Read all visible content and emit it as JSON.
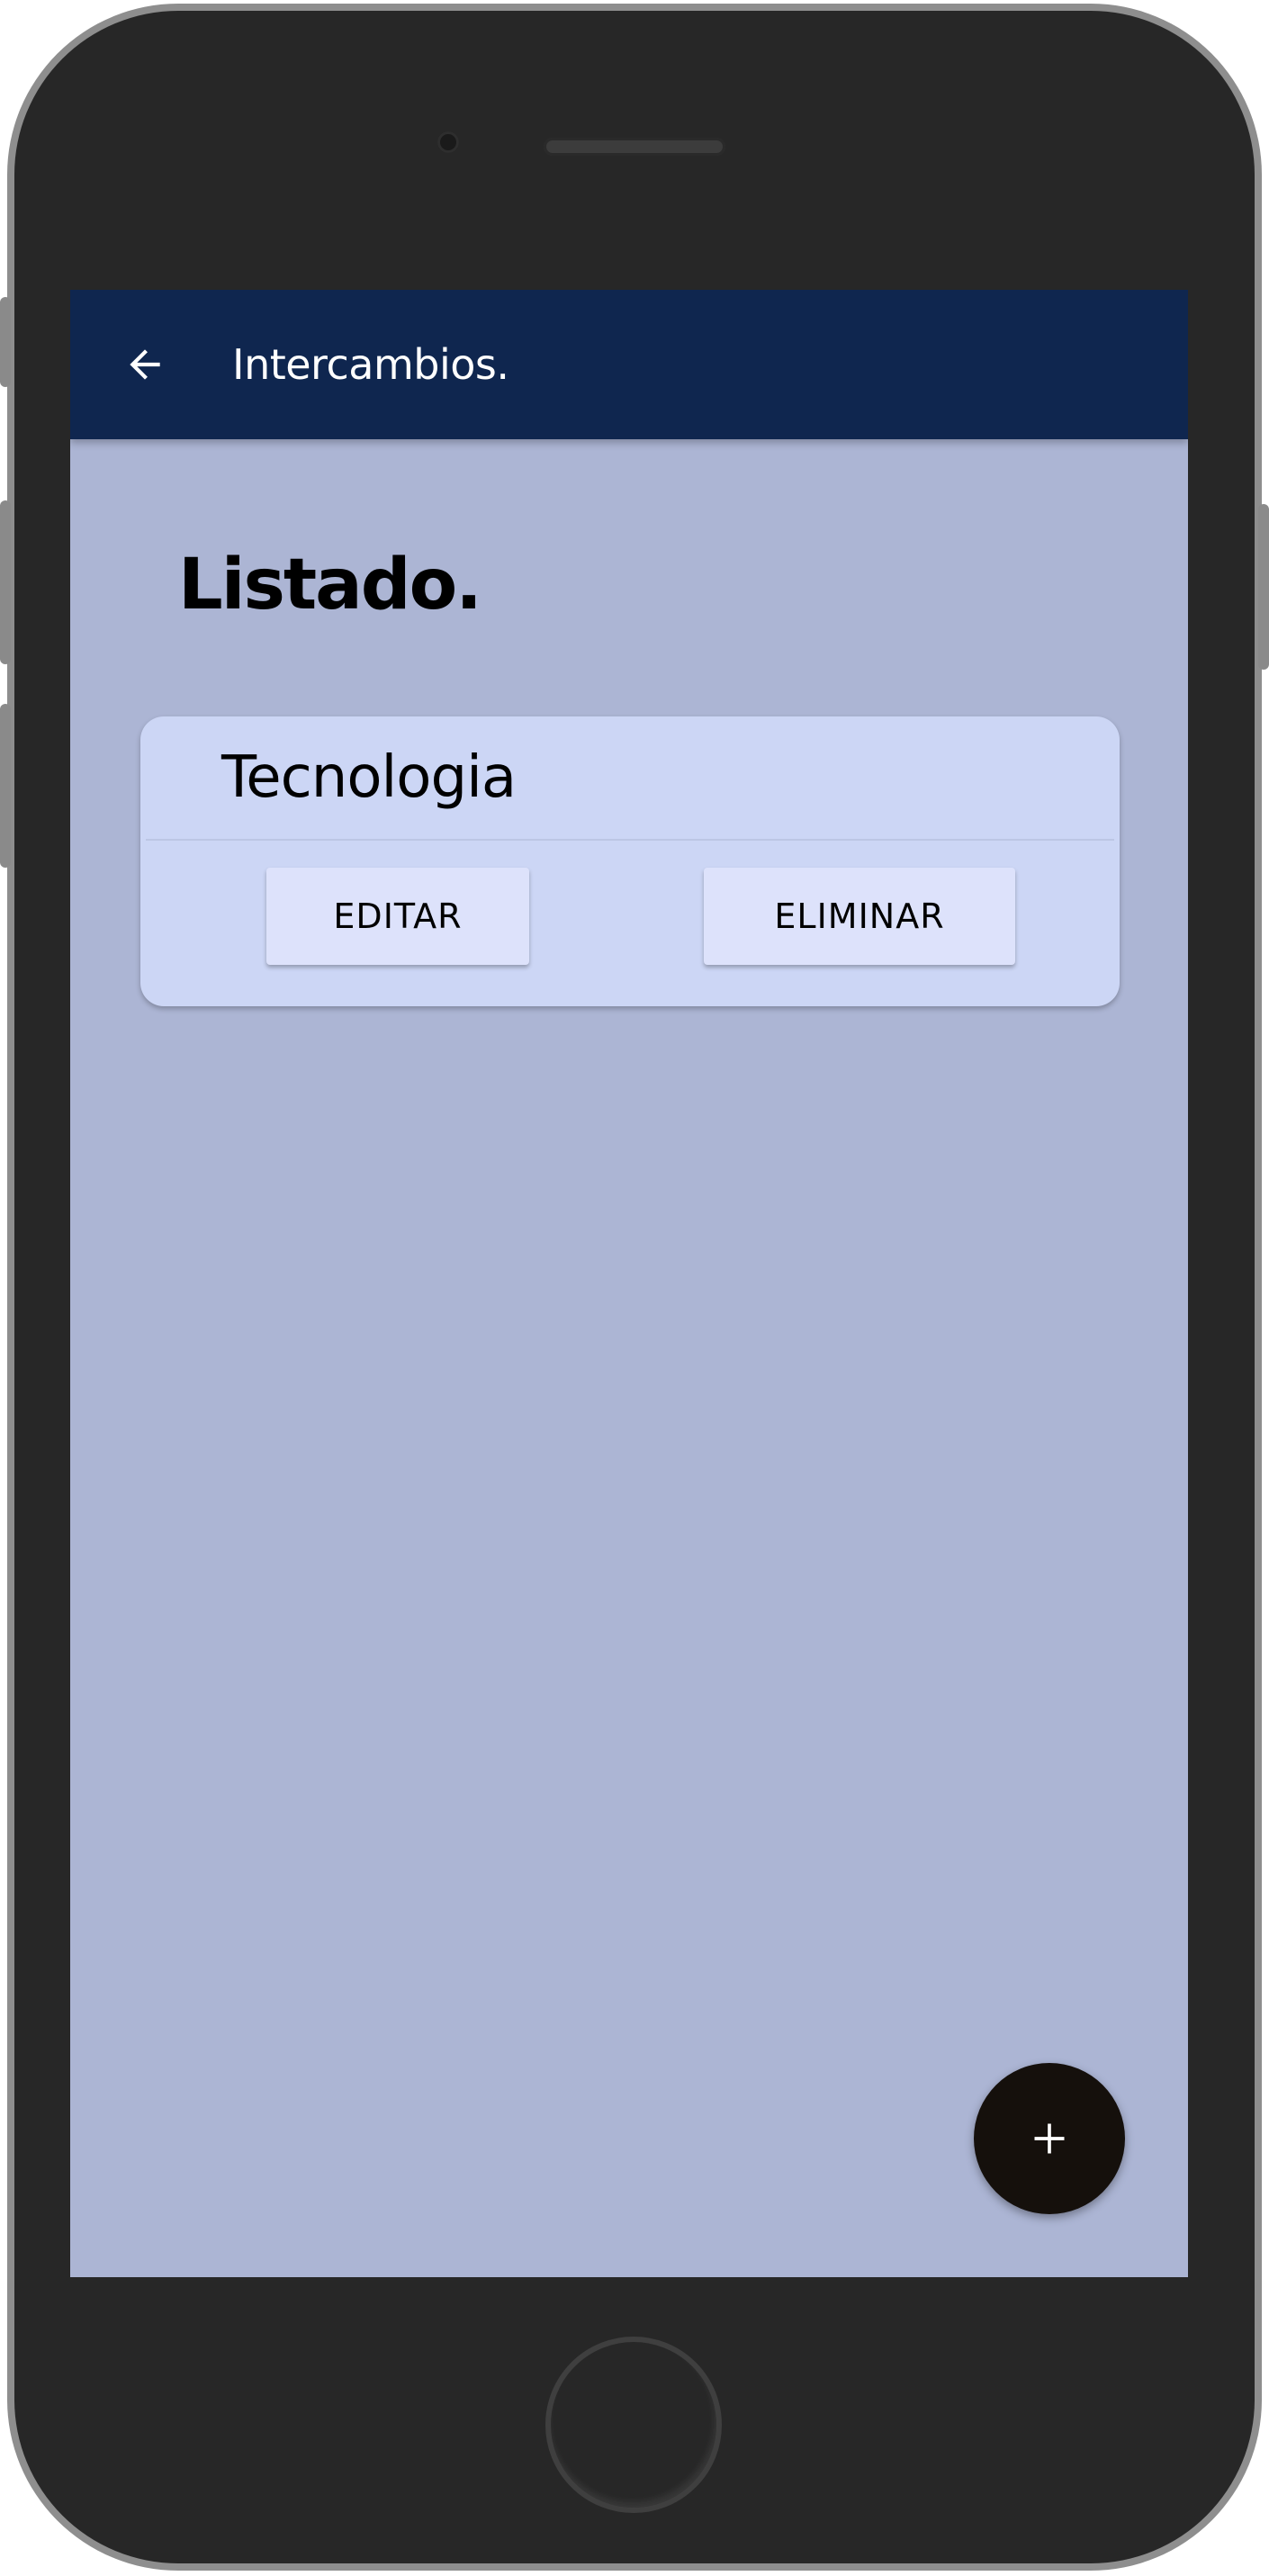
{
  "appbar": {
    "title": "Intercambios.",
    "back_icon": "arrow-left-icon",
    "background": "#0f264f"
  },
  "main": {
    "heading": "Listado.",
    "background": "#acb5d4"
  },
  "items": [
    {
      "title": "Tecnologia",
      "edit_label": "EDITAR",
      "delete_label": "ELIMINAR"
    }
  ],
  "fab": {
    "icon": "plus-icon",
    "background": "#15100c"
  },
  "device": {
    "home_button_icon": "home-button",
    "camera_icon": "front-camera",
    "speaker_icon": "earpiece-speaker"
  }
}
